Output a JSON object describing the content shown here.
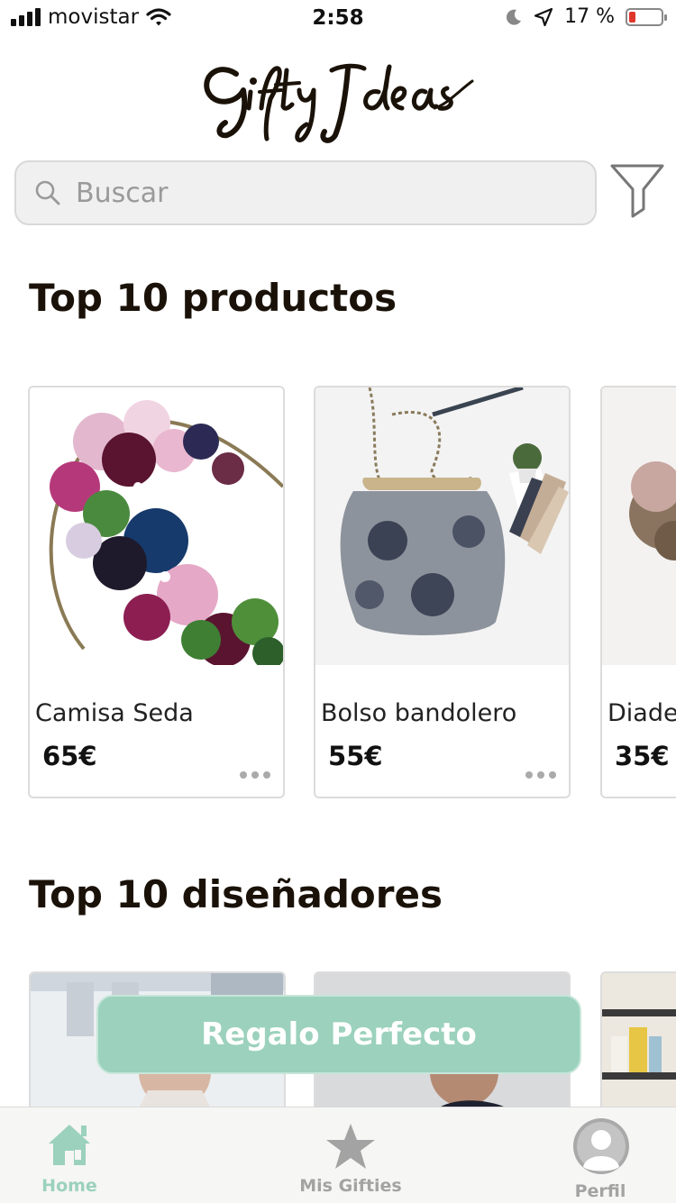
{
  "status_bar": {
    "carrier": "movistar",
    "time": "2:58",
    "battery_percent": "17 %",
    "battery_level": 0.17,
    "icons": [
      "signal-icon",
      "wifi-icon",
      "moon-icon",
      "location-arrow-icon",
      "battery-icon"
    ]
  },
  "header": {
    "logo_text": "Gifty Ideas"
  },
  "search": {
    "placeholder": "Buscar",
    "value": ""
  },
  "sections": {
    "top_products": {
      "title": "Top 10 productos",
      "items": [
        {
          "name": "Camisa Seda",
          "price": "65€"
        },
        {
          "name": "Bolso bandolero",
          "price": "55€"
        },
        {
          "name": "Diade",
          "price": "35€"
        }
      ]
    },
    "top_designers": {
      "title": "Top 10 diseñadores"
    }
  },
  "cta": {
    "label": "Regalo Perfecto"
  },
  "tabbar": {
    "items": [
      {
        "label": "Home",
        "icon": "home-icon"
      },
      {
        "label": "Mis Gifties",
        "icon": "star-icon"
      },
      {
        "label": "Perfil",
        "icon": "profile-avatar-icon"
      }
    ]
  },
  "colors": {
    "accent": "#9bd1bd",
    "tab_active": "#9bd1bd",
    "tab_inactive": "#a3a3a3",
    "title": "#1a1208"
  }
}
